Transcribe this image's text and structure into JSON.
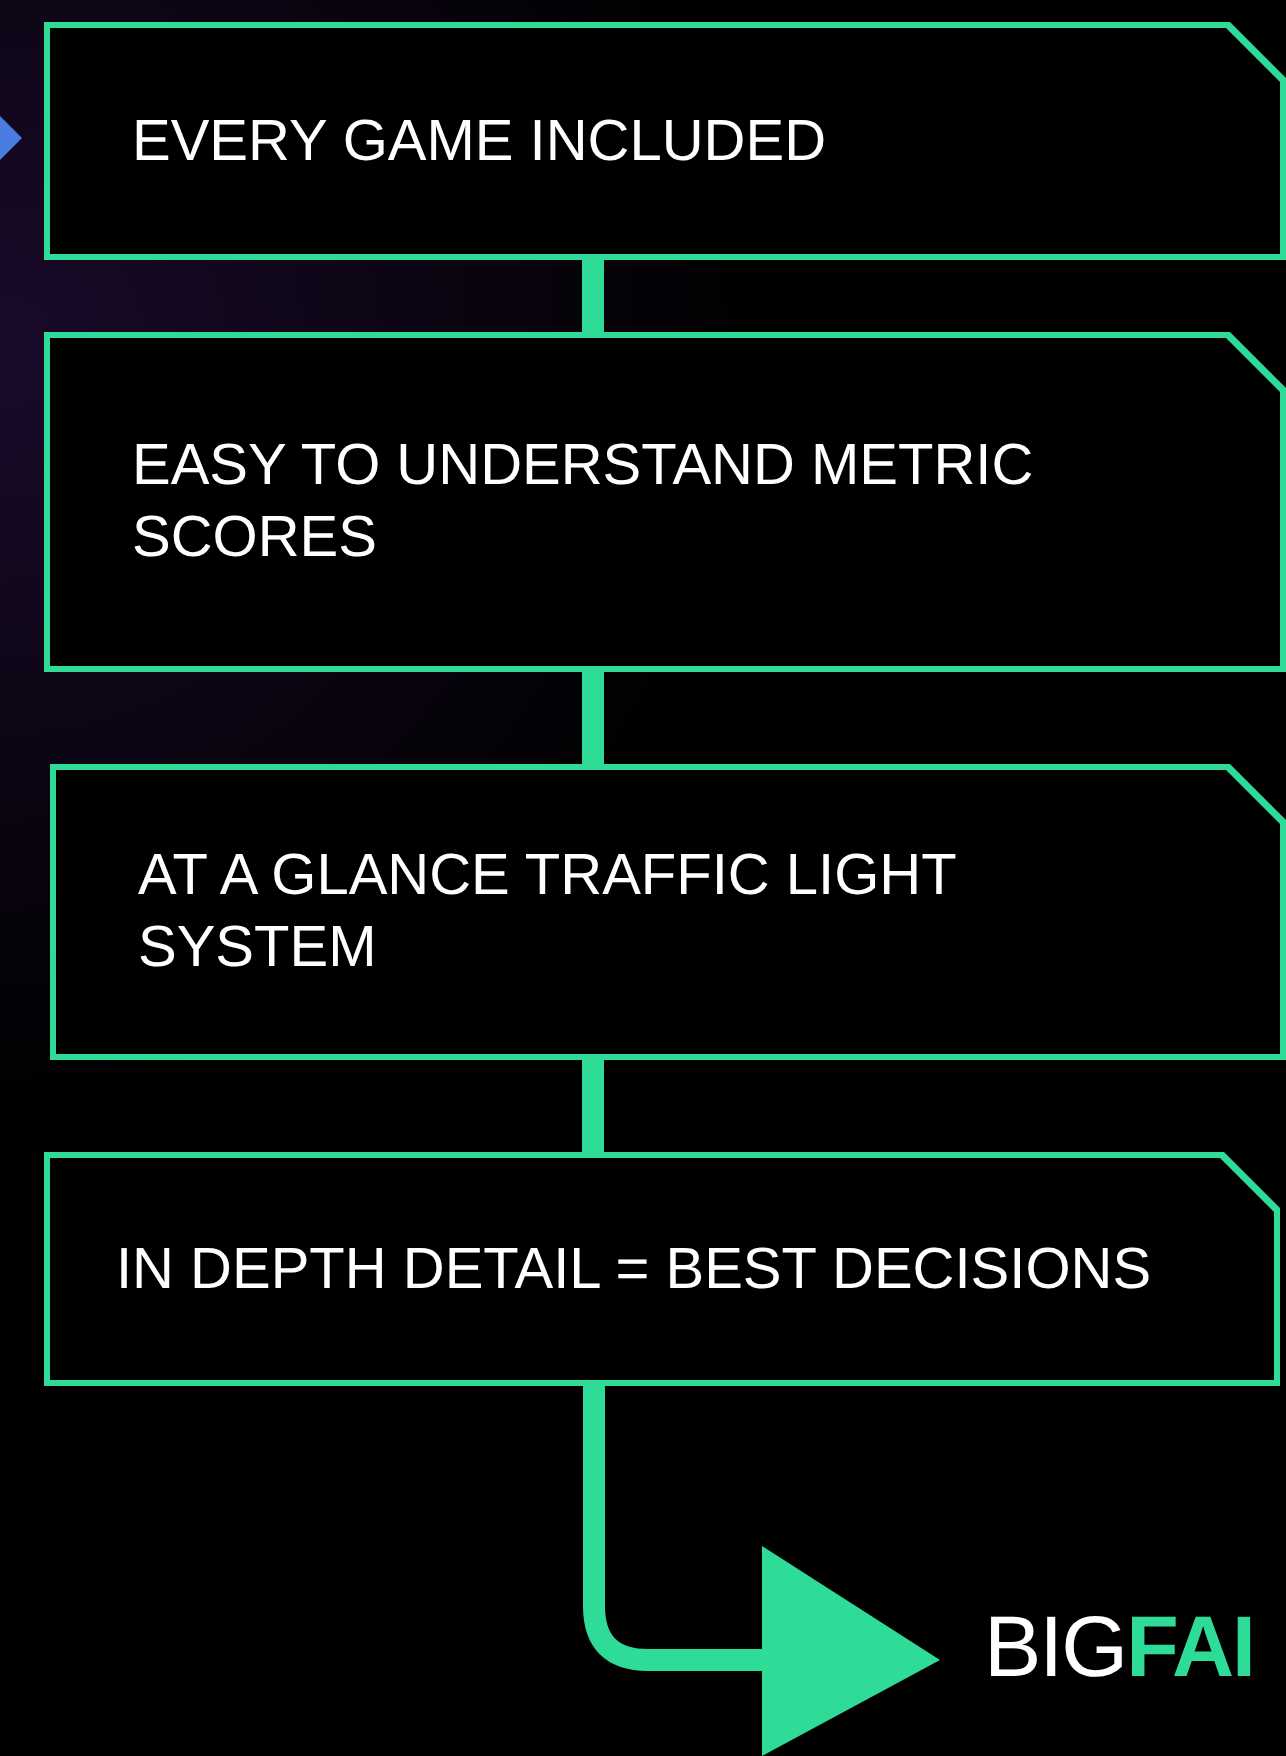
{
  "steps": [
    {
      "text": "EVERY GAME INCLUDED"
    },
    {
      "text": "EASY TO UNDERSTAND METRIC SCORES"
    },
    {
      "text": "AT A GLANCE TRAFFIC LIGHT SYSTEM"
    },
    {
      "text": "IN DEPTH DETAIL = BEST DECISIONS"
    }
  ],
  "brand": {
    "text": "BIG**FAI**"
  }
}
